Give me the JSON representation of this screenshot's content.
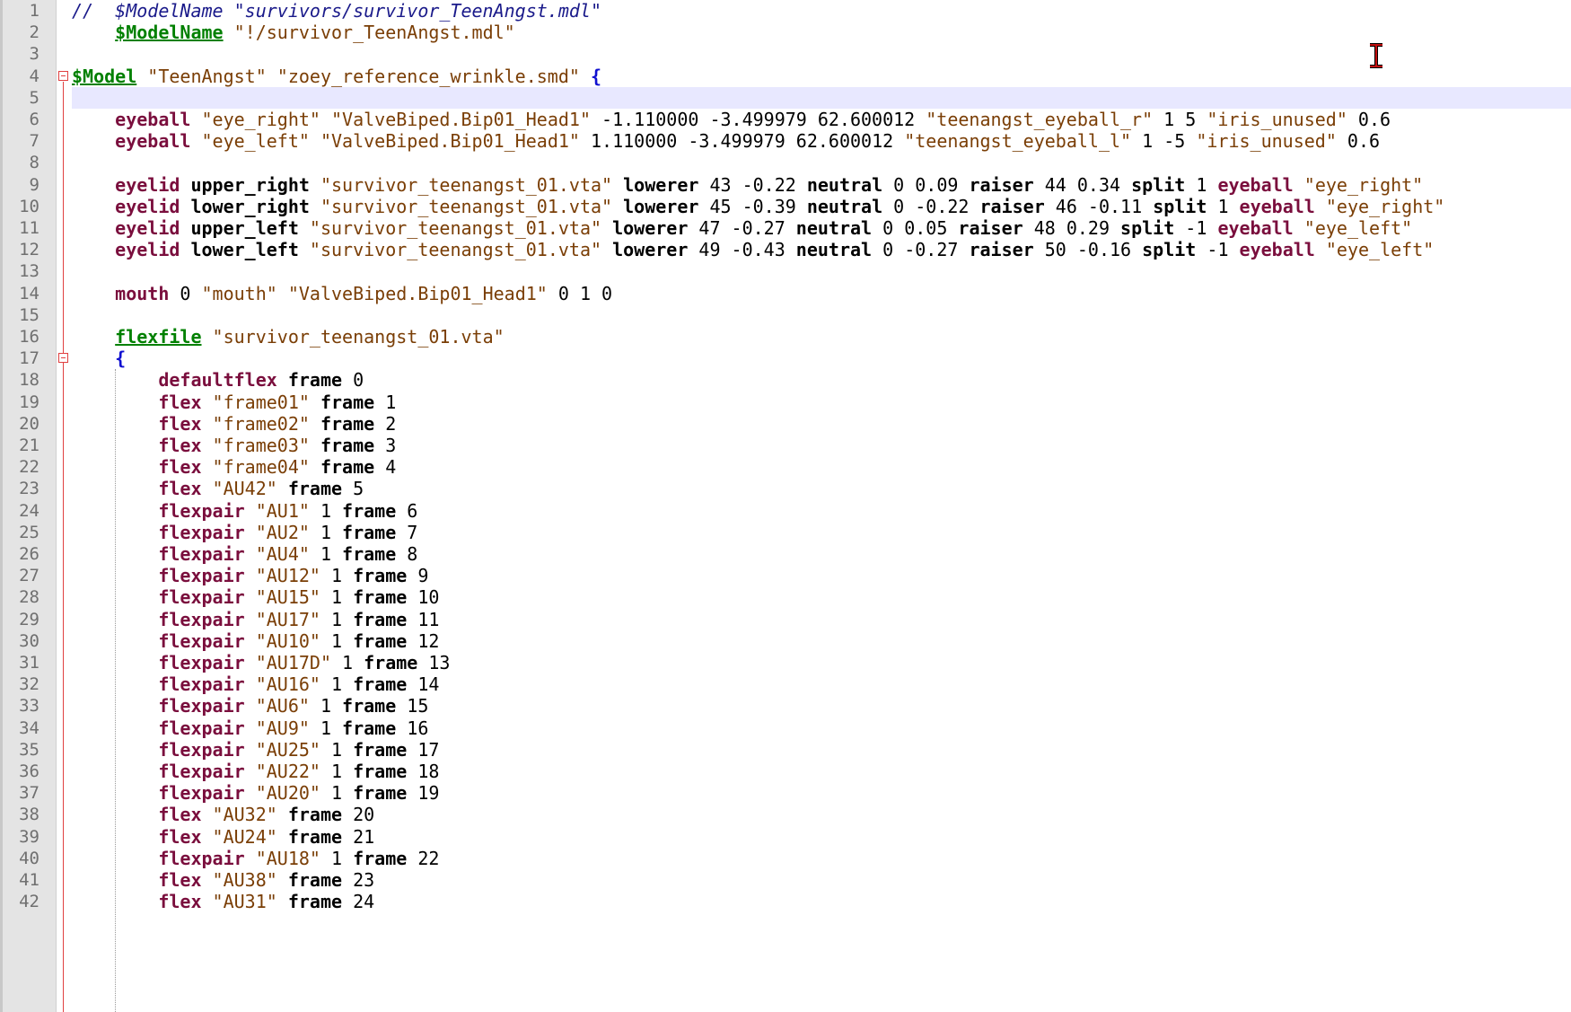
{
  "editor": {
    "line_numbers": [
      "1",
      "2",
      "3",
      "4",
      "5",
      "6",
      "7",
      "8",
      "9",
      "10",
      "11",
      "12",
      "13",
      "14",
      "15",
      "16",
      "17",
      "18",
      "19",
      "20",
      "21",
      "22",
      "23",
      "24",
      "25",
      "26",
      "27",
      "28",
      "29",
      "30",
      "31",
      "32",
      "33",
      "34",
      "35",
      "36",
      "37",
      "38",
      "39",
      "40",
      "41",
      "42"
    ],
    "lines": [
      [
        {
          "t": "//  $ModelName \"survivors/survivor_TeenAngst.mdl\"",
          "c": "cmt"
        }
      ],
      [
        {
          "t": "    ",
          "c": ""
        },
        {
          "t": "$ModelName",
          "c": "dir"
        },
        {
          "t": " \"!/survivor_TeenAngst.mdl\"",
          "c": "str"
        }
      ],
      [],
      [
        {
          "t": "$Model",
          "c": "dir"
        },
        {
          "t": " \"TeenAngst\" \"zoey_reference_wrinkle.smd\" ",
          "c": "str"
        },
        {
          "t": "{",
          "c": "brace"
        }
      ],
      [],
      [
        {
          "t": "    ",
          "c": ""
        },
        {
          "t": "eyeball",
          "c": "kw"
        },
        {
          "t": " \"eye_right\" \"ValveBiped.Bip01_Head1\" ",
          "c": "str"
        },
        {
          "t": "-1.110000 -3.499979 62.600012 ",
          "c": "num"
        },
        {
          "t": "\"teenangst_eyeball_r\" ",
          "c": "str"
        },
        {
          "t": "1 5 ",
          "c": "num"
        },
        {
          "t": "\"iris_unused\" ",
          "c": "str"
        },
        {
          "t": "0.6",
          "c": "num"
        }
      ],
      [
        {
          "t": "    ",
          "c": ""
        },
        {
          "t": "eyeball",
          "c": "kw"
        },
        {
          "t": " \"eye_left\" \"ValveBiped.Bip01_Head1\" ",
          "c": "str"
        },
        {
          "t": "1.110000 -3.499979 62.600012 ",
          "c": "num"
        },
        {
          "t": "\"teenangst_eyeball_l\" ",
          "c": "str"
        },
        {
          "t": "1 -5 ",
          "c": "num"
        },
        {
          "t": "\"iris_unused\" ",
          "c": "str"
        },
        {
          "t": "0.6",
          "c": "num"
        }
      ],
      [],
      [
        {
          "t": "    ",
          "c": ""
        },
        {
          "t": "eyelid",
          "c": "kw"
        },
        {
          "t": " upper_right ",
          "c": "kw2"
        },
        {
          "t": "\"survivor_teenangst_01.vta\" ",
          "c": "str"
        },
        {
          "t": "lowerer",
          "c": "kw2"
        },
        {
          "t": " 43 -0.22 ",
          "c": "num"
        },
        {
          "t": "neutral",
          "c": "kw2"
        },
        {
          "t": " 0 0.09 ",
          "c": "num"
        },
        {
          "t": "raiser",
          "c": "kw2"
        },
        {
          "t": " 44 0.34 ",
          "c": "num"
        },
        {
          "t": "split",
          "c": "kw2"
        },
        {
          "t": " 1 ",
          "c": "num"
        },
        {
          "t": "eyeball",
          "c": "kw"
        },
        {
          "t": " \"eye_right\"",
          "c": "str"
        }
      ],
      [
        {
          "t": "    ",
          "c": ""
        },
        {
          "t": "eyelid",
          "c": "kw"
        },
        {
          "t": " lower_right ",
          "c": "kw2"
        },
        {
          "t": "\"survivor_teenangst_01.vta\" ",
          "c": "str"
        },
        {
          "t": "lowerer",
          "c": "kw2"
        },
        {
          "t": " 45 -0.39 ",
          "c": "num"
        },
        {
          "t": "neutral",
          "c": "kw2"
        },
        {
          "t": " 0 -0.22 ",
          "c": "num"
        },
        {
          "t": "raiser",
          "c": "kw2"
        },
        {
          "t": " 46 -0.11 ",
          "c": "num"
        },
        {
          "t": "split",
          "c": "kw2"
        },
        {
          "t": " 1 ",
          "c": "num"
        },
        {
          "t": "eyeball",
          "c": "kw"
        },
        {
          "t": " \"eye_right\"",
          "c": "str"
        }
      ],
      [
        {
          "t": "    ",
          "c": ""
        },
        {
          "t": "eyelid",
          "c": "kw"
        },
        {
          "t": " upper_left ",
          "c": "kw2"
        },
        {
          "t": "\"survivor_teenangst_01.vta\" ",
          "c": "str"
        },
        {
          "t": "lowerer",
          "c": "kw2"
        },
        {
          "t": " 47 -0.27 ",
          "c": "num"
        },
        {
          "t": "neutral",
          "c": "kw2"
        },
        {
          "t": " 0 0.05 ",
          "c": "num"
        },
        {
          "t": "raiser",
          "c": "kw2"
        },
        {
          "t": " 48 0.29 ",
          "c": "num"
        },
        {
          "t": "split",
          "c": "kw2"
        },
        {
          "t": " -1 ",
          "c": "num"
        },
        {
          "t": "eyeball",
          "c": "kw"
        },
        {
          "t": " \"eye_left\"",
          "c": "str"
        }
      ],
      [
        {
          "t": "    ",
          "c": ""
        },
        {
          "t": "eyelid",
          "c": "kw"
        },
        {
          "t": " lower_left ",
          "c": "kw2"
        },
        {
          "t": "\"survivor_teenangst_01.vta\" ",
          "c": "str"
        },
        {
          "t": "lowerer",
          "c": "kw2"
        },
        {
          "t": " 49 -0.43 ",
          "c": "num"
        },
        {
          "t": "neutral",
          "c": "kw2"
        },
        {
          "t": " 0 -0.27 ",
          "c": "num"
        },
        {
          "t": "raiser",
          "c": "kw2"
        },
        {
          "t": " 50 -0.16 ",
          "c": "num"
        },
        {
          "t": "split",
          "c": "kw2"
        },
        {
          "t": " -1 ",
          "c": "num"
        },
        {
          "t": "eyeball",
          "c": "kw"
        },
        {
          "t": " \"eye_left\"",
          "c": "str"
        }
      ],
      [],
      [
        {
          "t": "    ",
          "c": ""
        },
        {
          "t": "mouth",
          "c": "kw"
        },
        {
          "t": " 0 ",
          "c": "num"
        },
        {
          "t": "\"mouth\" \"ValveBiped.Bip01_Head1\" ",
          "c": "str"
        },
        {
          "t": "0 1 0",
          "c": "num"
        }
      ],
      [],
      [
        {
          "t": "    ",
          "c": ""
        },
        {
          "t": "flexfile",
          "c": "dir"
        },
        {
          "t": " \"survivor_teenangst_01.vta\"",
          "c": "str"
        }
      ],
      [
        {
          "t": "    ",
          "c": ""
        },
        {
          "t": "{",
          "c": "brace"
        }
      ],
      [
        {
          "t": "        ",
          "c": ""
        },
        {
          "t": "defaultflex",
          "c": "kw"
        },
        {
          "t": " frame",
          "c": "kw2"
        },
        {
          "t": " 0",
          "c": "num"
        }
      ],
      [
        {
          "t": "        ",
          "c": ""
        },
        {
          "t": "flex",
          "c": "kw"
        },
        {
          "t": " \"frame01\" ",
          "c": "str"
        },
        {
          "t": "frame",
          "c": "kw2"
        },
        {
          "t": " 1",
          "c": "num"
        }
      ],
      [
        {
          "t": "        ",
          "c": ""
        },
        {
          "t": "flex",
          "c": "kw"
        },
        {
          "t": " \"frame02\" ",
          "c": "str"
        },
        {
          "t": "frame",
          "c": "kw2"
        },
        {
          "t": " 2",
          "c": "num"
        }
      ],
      [
        {
          "t": "        ",
          "c": ""
        },
        {
          "t": "flex",
          "c": "kw"
        },
        {
          "t": " \"frame03\" ",
          "c": "str"
        },
        {
          "t": "frame",
          "c": "kw2"
        },
        {
          "t": " 3",
          "c": "num"
        }
      ],
      [
        {
          "t": "        ",
          "c": ""
        },
        {
          "t": "flex",
          "c": "kw"
        },
        {
          "t": " \"frame04\" ",
          "c": "str"
        },
        {
          "t": "frame",
          "c": "kw2"
        },
        {
          "t": " 4",
          "c": "num"
        }
      ],
      [
        {
          "t": "        ",
          "c": ""
        },
        {
          "t": "flex",
          "c": "kw"
        },
        {
          "t": " \"AU42\" ",
          "c": "str"
        },
        {
          "t": "frame",
          "c": "kw2"
        },
        {
          "t": " 5",
          "c": "num"
        }
      ],
      [
        {
          "t": "        ",
          "c": ""
        },
        {
          "t": "flexpair",
          "c": "kw"
        },
        {
          "t": " \"AU1\" ",
          "c": "str"
        },
        {
          "t": "1 ",
          "c": "num"
        },
        {
          "t": "frame",
          "c": "kw2"
        },
        {
          "t": " 6",
          "c": "num"
        }
      ],
      [
        {
          "t": "        ",
          "c": ""
        },
        {
          "t": "flexpair",
          "c": "kw"
        },
        {
          "t": " \"AU2\" ",
          "c": "str"
        },
        {
          "t": "1 ",
          "c": "num"
        },
        {
          "t": "frame",
          "c": "kw2"
        },
        {
          "t": " 7",
          "c": "num"
        }
      ],
      [
        {
          "t": "        ",
          "c": ""
        },
        {
          "t": "flexpair",
          "c": "kw"
        },
        {
          "t": " \"AU4\" ",
          "c": "str"
        },
        {
          "t": "1 ",
          "c": "num"
        },
        {
          "t": "frame",
          "c": "kw2"
        },
        {
          "t": " 8",
          "c": "num"
        }
      ],
      [
        {
          "t": "        ",
          "c": ""
        },
        {
          "t": "flexpair",
          "c": "kw"
        },
        {
          "t": " \"AU12\" ",
          "c": "str"
        },
        {
          "t": "1 ",
          "c": "num"
        },
        {
          "t": "frame",
          "c": "kw2"
        },
        {
          "t": " 9",
          "c": "num"
        }
      ],
      [
        {
          "t": "        ",
          "c": ""
        },
        {
          "t": "flexpair",
          "c": "kw"
        },
        {
          "t": " \"AU15\" ",
          "c": "str"
        },
        {
          "t": "1 ",
          "c": "num"
        },
        {
          "t": "frame",
          "c": "kw2"
        },
        {
          "t": " 10",
          "c": "num"
        }
      ],
      [
        {
          "t": "        ",
          "c": ""
        },
        {
          "t": "flexpair",
          "c": "kw"
        },
        {
          "t": " \"AU17\" ",
          "c": "str"
        },
        {
          "t": "1 ",
          "c": "num"
        },
        {
          "t": "frame",
          "c": "kw2"
        },
        {
          "t": " 11",
          "c": "num"
        }
      ],
      [
        {
          "t": "        ",
          "c": ""
        },
        {
          "t": "flexpair",
          "c": "kw"
        },
        {
          "t": " \"AU10\" ",
          "c": "str"
        },
        {
          "t": "1 ",
          "c": "num"
        },
        {
          "t": "frame",
          "c": "kw2"
        },
        {
          "t": " 12",
          "c": "num"
        }
      ],
      [
        {
          "t": "        ",
          "c": ""
        },
        {
          "t": "flexpair",
          "c": "kw"
        },
        {
          "t": " \"AU17D\" ",
          "c": "str"
        },
        {
          "t": "1 ",
          "c": "num"
        },
        {
          "t": "frame",
          "c": "kw2"
        },
        {
          "t": " 13",
          "c": "num"
        }
      ],
      [
        {
          "t": "        ",
          "c": ""
        },
        {
          "t": "flexpair",
          "c": "kw"
        },
        {
          "t": " \"AU16\" ",
          "c": "str"
        },
        {
          "t": "1 ",
          "c": "num"
        },
        {
          "t": "frame",
          "c": "kw2"
        },
        {
          "t": " 14",
          "c": "num"
        }
      ],
      [
        {
          "t": "        ",
          "c": ""
        },
        {
          "t": "flexpair",
          "c": "kw"
        },
        {
          "t": " \"AU6\" ",
          "c": "str"
        },
        {
          "t": "1 ",
          "c": "num"
        },
        {
          "t": "frame",
          "c": "kw2"
        },
        {
          "t": " 15",
          "c": "num"
        }
      ],
      [
        {
          "t": "        ",
          "c": ""
        },
        {
          "t": "flexpair",
          "c": "kw"
        },
        {
          "t": " \"AU9\" ",
          "c": "str"
        },
        {
          "t": "1 ",
          "c": "num"
        },
        {
          "t": "frame",
          "c": "kw2"
        },
        {
          "t": " 16",
          "c": "num"
        }
      ],
      [
        {
          "t": "        ",
          "c": ""
        },
        {
          "t": "flexpair",
          "c": "kw"
        },
        {
          "t": " \"AU25\" ",
          "c": "str"
        },
        {
          "t": "1 ",
          "c": "num"
        },
        {
          "t": "frame",
          "c": "kw2"
        },
        {
          "t": " 17",
          "c": "num"
        }
      ],
      [
        {
          "t": "        ",
          "c": ""
        },
        {
          "t": "flexpair",
          "c": "kw"
        },
        {
          "t": " \"AU22\" ",
          "c": "str"
        },
        {
          "t": "1 ",
          "c": "num"
        },
        {
          "t": "frame",
          "c": "kw2"
        },
        {
          "t": " 18",
          "c": "num"
        }
      ],
      [
        {
          "t": "        ",
          "c": ""
        },
        {
          "t": "flexpair",
          "c": "kw"
        },
        {
          "t": " \"AU20\" ",
          "c": "str"
        },
        {
          "t": "1 ",
          "c": "num"
        },
        {
          "t": "frame",
          "c": "kw2"
        },
        {
          "t": " 19",
          "c": "num"
        }
      ],
      [
        {
          "t": "        ",
          "c": ""
        },
        {
          "t": "flex",
          "c": "kw"
        },
        {
          "t": " \"AU32\" ",
          "c": "str"
        },
        {
          "t": "frame",
          "c": "kw2"
        },
        {
          "t": " 20",
          "c": "num"
        }
      ],
      [
        {
          "t": "        ",
          "c": ""
        },
        {
          "t": "flex",
          "c": "kw"
        },
        {
          "t": " \"AU24\" ",
          "c": "str"
        },
        {
          "t": "frame",
          "c": "kw2"
        },
        {
          "t": " 21",
          "c": "num"
        }
      ],
      [
        {
          "t": "        ",
          "c": ""
        },
        {
          "t": "flexpair",
          "c": "kw"
        },
        {
          "t": " \"AU18\" ",
          "c": "str"
        },
        {
          "t": "1 ",
          "c": "num"
        },
        {
          "t": "frame",
          "c": "kw2"
        },
        {
          "t": " 22",
          "c": "num"
        }
      ],
      [
        {
          "t": "        ",
          "c": ""
        },
        {
          "t": "flex",
          "c": "kw"
        },
        {
          "t": " \"AU38\" ",
          "c": "str"
        },
        {
          "t": "frame",
          "c": "kw2"
        },
        {
          "t": " 23",
          "c": "num"
        }
      ],
      [
        {
          "t": "        ",
          "c": ""
        },
        {
          "t": "flex",
          "c": "kw"
        },
        {
          "t": " \"AU31\" ",
          "c": "str"
        },
        {
          "t": "frame",
          "c": "kw2"
        },
        {
          "t": " 24",
          "c": "num"
        }
      ]
    ],
    "current_line": 5,
    "fold_markers": [
      4,
      17
    ],
    "icons": {
      "cursor": "text-ibeam-cursor-icon",
      "fold": "fold-collapse-icon"
    },
    "colors": {
      "keyword": "#7a0e3d",
      "directive": "#008000",
      "string": "#7a3e06",
      "comment": "#1a1a8a",
      "brace": "#1010d0",
      "current_line": "#e8e8ff",
      "fold": "#e04040"
    }
  }
}
